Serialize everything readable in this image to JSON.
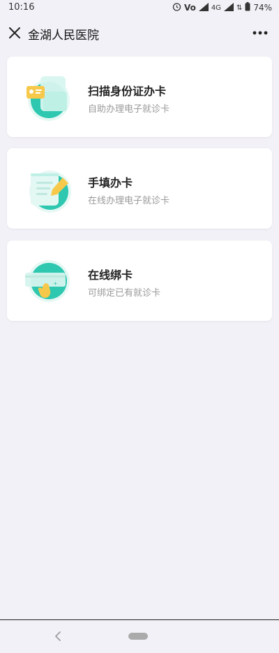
{
  "status": {
    "time": "10:16",
    "battery": "74%",
    "network": "4G"
  },
  "nav": {
    "title": "金湖人民医院"
  },
  "cards": [
    {
      "title": "扫描身份证办卡",
      "subtitle": "自助办理电子就诊卡",
      "icon": "id-card-scan-icon"
    },
    {
      "title": "手填办卡",
      "subtitle": "在线办理电子就诊卡",
      "icon": "handwrite-form-icon"
    },
    {
      "title": "在线绑卡",
      "subtitle": "可绑定已有就诊卡",
      "icon": "bind-card-icon"
    }
  ],
  "colors": {
    "accent": "#2ec7b0",
    "accent_light": "#bff0e6",
    "card_yellow": "#f7c94b",
    "background": "#f2f1f7"
  }
}
